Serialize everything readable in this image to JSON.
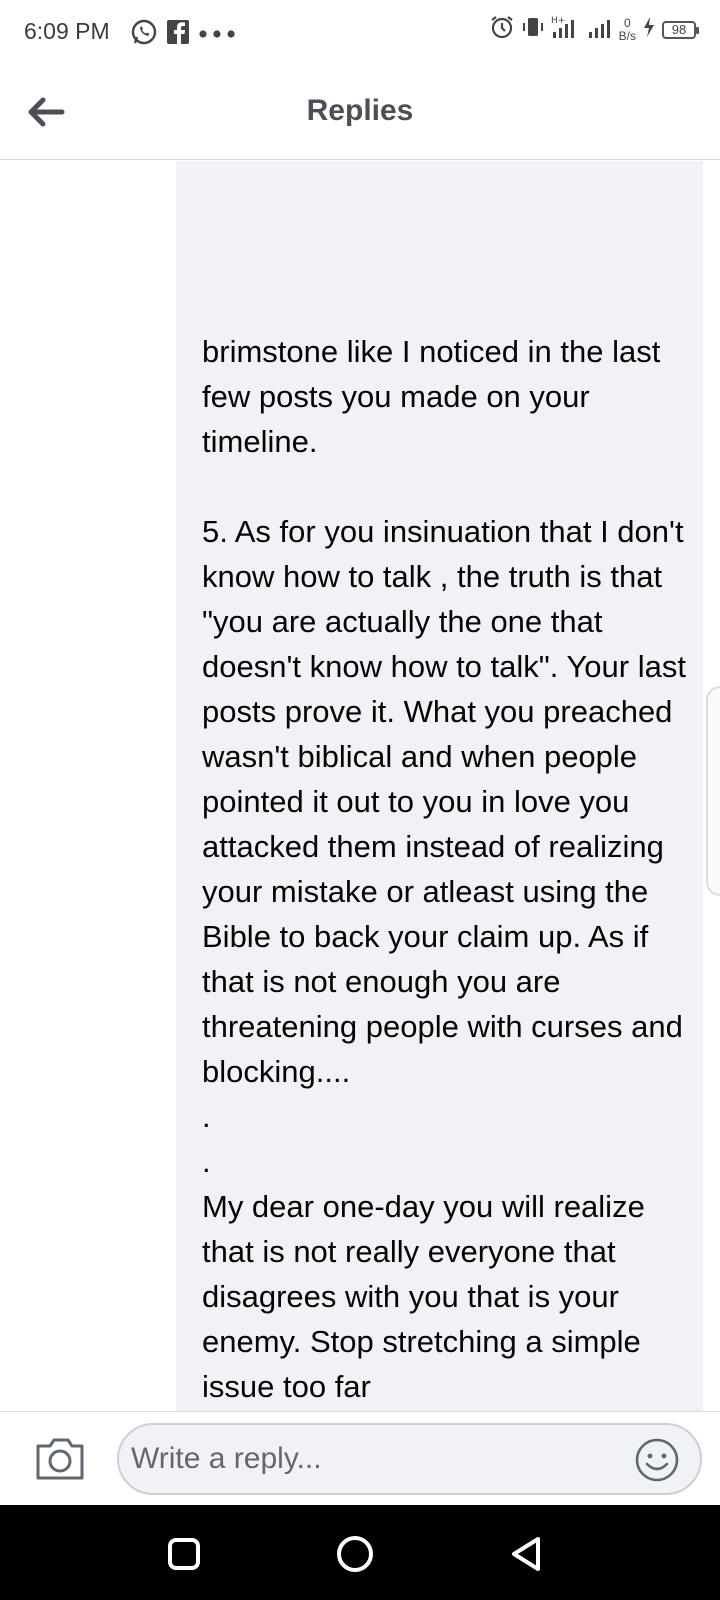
{
  "status_bar": {
    "time": "6:09 PM",
    "net_speed_value": "0",
    "net_speed_unit": "B/s",
    "battery_level": "98",
    "left_icons": [
      "whatsapp-icon",
      "facebook-icon",
      "more-dots-icon"
    ],
    "right_icons": [
      "alarm-icon",
      "vibrate-icon",
      "signal-icon",
      "signal-icon",
      "charging-icon",
      "battery-icon"
    ]
  },
  "header": {
    "title": "Replies",
    "back_icon": "back-arrow-icon"
  },
  "reply_bubble": {
    "paragraphs": [
      "brimstone like I noticed in the last few posts you made on your timeline.",
      "",
      "5. As for you insinuation that I don't know how to talk , the truth is that \"you are actually the one that doesn't know how to talk\". Your last posts prove it. What you preached wasn't biblical and when people pointed it out to you in love you attacked them instead of realizing your mistake or atleast using the Bible to back your claim up. As if that is not enough you are threatening people with curses and blocking....",
      ".",
      ".",
      "My dear one-day you will realize that is not really everyone that disagrees with you that is your enemy. Stop stretching a simple issue too far"
    ]
  },
  "composer": {
    "placeholder": "Write a reply...",
    "value": "",
    "camera_icon": "camera-icon",
    "emoji_icon": "emoji-icon"
  },
  "nav_bar": {
    "buttons": [
      "recent-apps-icon",
      "home-icon",
      "back-icon"
    ]
  },
  "colors": {
    "bubble_bg": "#f0f2f5",
    "header_title": "#4b4f56",
    "text": "#050505",
    "placeholder": "#65676b",
    "nav_bg": "#000000"
  }
}
